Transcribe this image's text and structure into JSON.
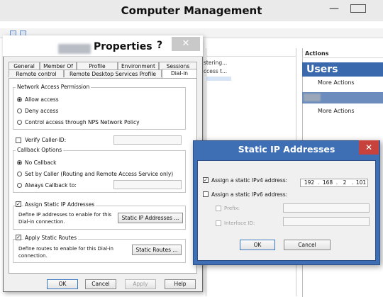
{
  "main_window": {
    "title": "Computer Management",
    "min_glyph": "—",
    "center_peek": [
      "stering...",
      "ccess t..."
    ],
    "actions": {
      "header": "Actions",
      "users_title": "Users",
      "more_actions_1": "More Actions",
      "more_actions_2": "More Actions"
    }
  },
  "properties": {
    "title": "Properties",
    "help": "?",
    "close": "✕",
    "tabs_row1": [
      "General",
      "Member Of",
      "Profile",
      "Environment",
      "Sessions"
    ],
    "tabs_row2": [
      "Remote control",
      "Remote Desktop Services Profile",
      "Dial-in"
    ],
    "active_tab": "Dial-in",
    "network_access": {
      "title": "Network Access Permission",
      "options": [
        "Allow access",
        "Deny access",
        "Control access through NPS Network Policy"
      ],
      "selected": "Allow access"
    },
    "verify_caller_id": "Verify Caller-ID:",
    "callback": {
      "title": "Callback Options",
      "options": [
        "No Callback",
        "Set by Caller (Routing and Remote Access Service only)",
        "Always Callback to:"
      ],
      "selected": "No Callback"
    },
    "static_ip": {
      "check_label": "Assign Static IP Addresses",
      "checked": true,
      "description_1": "Define IP addresses to enable for this",
      "description_2": "Dial-in connection.",
      "button": "Static IP Addresses ..."
    },
    "static_routes": {
      "check_label": "Apply Static Routes",
      "checked": true,
      "description_1": "Define routes to enable for this Dial-in",
      "description_2": "connection.",
      "button": "Static Routes ..."
    },
    "buttons": {
      "ok": "OK",
      "cancel": "Cancel",
      "apply": "Apply",
      "help": "Help"
    }
  },
  "static_ip_dialog": {
    "title": "Static IP Addresses",
    "close": "✕",
    "ipv4_label": "Assign a static IPv4 address:",
    "ipv4_checked": true,
    "ipv4": [
      "192",
      "168",
      "2",
      "101"
    ],
    "ipv4_dot": ".",
    "ipv6_label": "Assign a static IPv6 address:",
    "ipv6_checked": false,
    "prefix_label": "Prefix:",
    "interface_id_label": "Interface ID:",
    "ok": "OK",
    "cancel": "Cancel"
  },
  "glyphs": {
    "check": "✓"
  },
  "colors": {
    "dialog_blue": "#3e6fb5",
    "actions_blue": "#3a6aad",
    "close_red": "#c8423d"
  }
}
